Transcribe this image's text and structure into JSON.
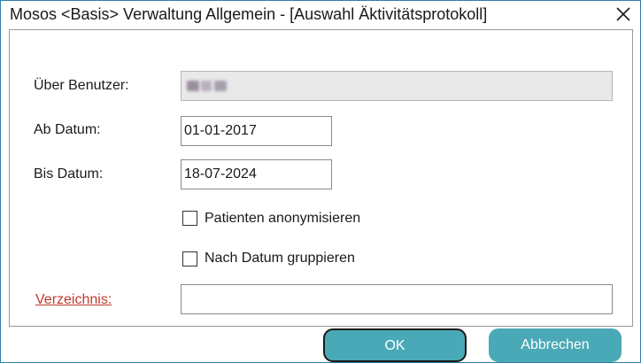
{
  "window": {
    "title": "Mosos <Basis> Verwaltung Allgemein - [Auswahl Äktivitätsprotokoll]"
  },
  "form": {
    "user_label": "Über Benutzer:",
    "user_value": "",
    "from_date_label": "Ab Datum:",
    "from_date_value": "01-01-2017",
    "to_date_label": "Bis Datum:",
    "to_date_value": "18-07-2024",
    "anonymize_label": "Patienten anonymisieren",
    "anonymize_checked": false,
    "group_by_date_label": "Nach Datum gruppieren",
    "group_by_date_checked": false,
    "directory_link": "Verzeichnis:",
    "directory_value": ""
  },
  "buttons": {
    "ok_label": "OK",
    "cancel_label": "Abbrechen"
  },
  "colors": {
    "window_border": "#2f7ea8",
    "button_fill": "#4aa9b6",
    "link": "#c0392b"
  }
}
